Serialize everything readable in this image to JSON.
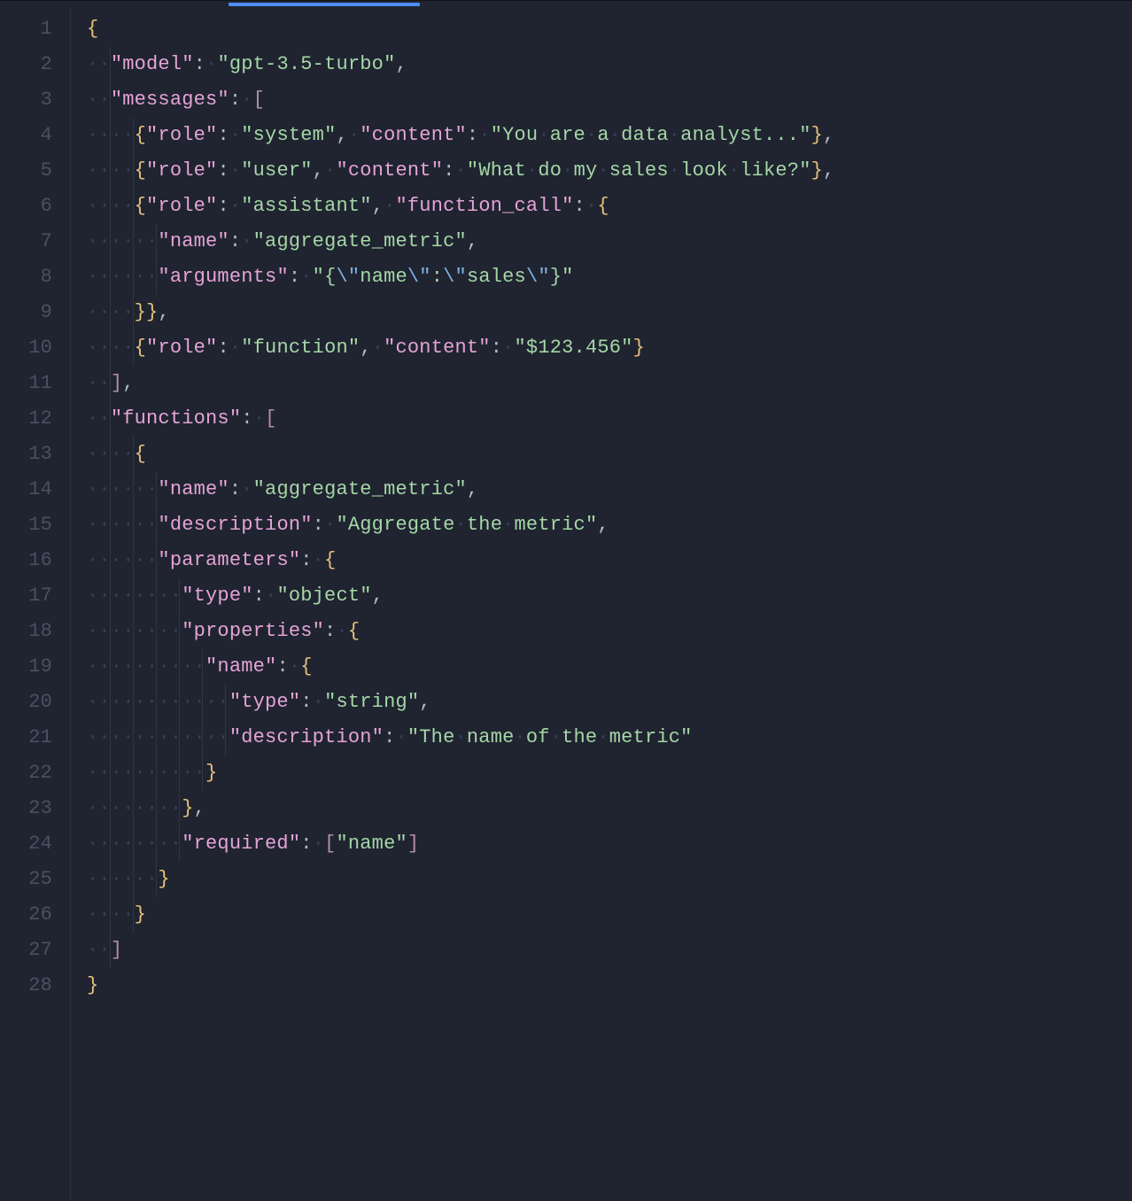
{
  "tab": {
    "active": true
  },
  "line_numbers": [
    "1",
    "2",
    "3",
    "4",
    "5",
    "6",
    "7",
    "8",
    "9",
    "10",
    "11",
    "12",
    "13",
    "14",
    "15",
    "16",
    "17",
    "18",
    "19",
    "20",
    "21",
    "22",
    "23",
    "24",
    "25",
    "26",
    "27",
    "28"
  ],
  "code_lines": [
    [
      {
        "t": "brace",
        "v": "{"
      }
    ],
    [
      {
        "t": "ws",
        "n": 2
      },
      {
        "t": "key",
        "v": "\"model\""
      },
      {
        "t": "punct",
        "v": ":"
      },
      {
        "t": "dot",
        "v": "·"
      },
      {
        "t": "str",
        "v": "\"gpt-3.5-turbo\""
      },
      {
        "t": "punct",
        "v": ","
      }
    ],
    [
      {
        "t": "ws",
        "n": 2
      },
      {
        "t": "key",
        "v": "\"messages\""
      },
      {
        "t": "punct",
        "v": ":"
      },
      {
        "t": "dot",
        "v": "·"
      },
      {
        "t": "bracket",
        "v": "["
      }
    ],
    [
      {
        "t": "ws",
        "n": 4
      },
      {
        "t": "brace",
        "v": "{"
      },
      {
        "t": "key",
        "v": "\"role\""
      },
      {
        "t": "punct",
        "v": ":"
      },
      {
        "t": "dot",
        "v": "·"
      },
      {
        "t": "str",
        "v": "\"system\""
      },
      {
        "t": "punct",
        "v": ","
      },
      {
        "t": "dot",
        "v": "·"
      },
      {
        "t": "key",
        "v": "\"content\""
      },
      {
        "t": "punct",
        "v": ":"
      },
      {
        "t": "dot",
        "v": "·"
      },
      {
        "t": "str",
        "v": "\"You·are·a·data·analyst...\""
      },
      {
        "t": "brace",
        "v": "}"
      },
      {
        "t": "punct",
        "v": ","
      }
    ],
    [
      {
        "t": "ws",
        "n": 4
      },
      {
        "t": "brace",
        "v": "{"
      },
      {
        "t": "key",
        "v": "\"role\""
      },
      {
        "t": "punct",
        "v": ":"
      },
      {
        "t": "dot",
        "v": "·"
      },
      {
        "t": "str",
        "v": "\"user\""
      },
      {
        "t": "punct",
        "v": ","
      },
      {
        "t": "dot",
        "v": "·"
      },
      {
        "t": "key",
        "v": "\"content\""
      },
      {
        "t": "punct",
        "v": ":"
      },
      {
        "t": "dot",
        "v": "·"
      },
      {
        "t": "str",
        "v": "\"What·do·my·sales·look·like?\""
      },
      {
        "t": "brace",
        "v": "}"
      },
      {
        "t": "punct",
        "v": ","
      }
    ],
    [
      {
        "t": "ws",
        "n": 4
      },
      {
        "t": "brace",
        "v": "{"
      },
      {
        "t": "key",
        "v": "\"role\""
      },
      {
        "t": "punct",
        "v": ":"
      },
      {
        "t": "dot",
        "v": "·"
      },
      {
        "t": "str",
        "v": "\"assistant\""
      },
      {
        "t": "punct",
        "v": ","
      },
      {
        "t": "dot",
        "v": "·"
      },
      {
        "t": "key",
        "v": "\"function_call\""
      },
      {
        "t": "punct",
        "v": ":"
      },
      {
        "t": "dot",
        "v": "·"
      },
      {
        "t": "brace",
        "v": "{"
      }
    ],
    [
      {
        "t": "ws",
        "n": 6
      },
      {
        "t": "key",
        "v": "\"name\""
      },
      {
        "t": "punct",
        "v": ":"
      },
      {
        "t": "dot",
        "v": "·"
      },
      {
        "t": "str",
        "v": "\"aggregate_metric\""
      },
      {
        "t": "punct",
        "v": ","
      }
    ],
    [
      {
        "t": "ws",
        "n": 6
      },
      {
        "t": "key",
        "v": "\"arguments\""
      },
      {
        "t": "punct",
        "v": ":"
      },
      {
        "t": "dot",
        "v": "·"
      },
      {
        "t": "str",
        "v": "\"{"
      },
      {
        "t": "esc",
        "v": "\\\""
      },
      {
        "t": "str",
        "v": "name"
      },
      {
        "t": "esc",
        "v": "\\\""
      },
      {
        "t": "str",
        "v": ":"
      },
      {
        "t": "esc",
        "v": "\\\""
      },
      {
        "t": "str",
        "v": "sales"
      },
      {
        "t": "esc",
        "v": "\\\""
      },
      {
        "t": "str",
        "v": "}\""
      }
    ],
    [
      {
        "t": "ws",
        "n": 4
      },
      {
        "t": "brace",
        "v": "}}"
      },
      {
        "t": "punct",
        "v": ","
      }
    ],
    [
      {
        "t": "ws",
        "n": 4
      },
      {
        "t": "brace",
        "v": "{"
      },
      {
        "t": "key",
        "v": "\"role\""
      },
      {
        "t": "punct",
        "v": ":"
      },
      {
        "t": "dot",
        "v": "·"
      },
      {
        "t": "str",
        "v": "\"function\""
      },
      {
        "t": "punct",
        "v": ","
      },
      {
        "t": "dot",
        "v": "·"
      },
      {
        "t": "key",
        "v": "\"content\""
      },
      {
        "t": "punct",
        "v": ":"
      },
      {
        "t": "dot",
        "v": "·"
      },
      {
        "t": "str",
        "v": "\"$123.456\""
      },
      {
        "t": "brace",
        "v": "}"
      }
    ],
    [
      {
        "t": "ws",
        "n": 2
      },
      {
        "t": "bracket",
        "v": "]"
      },
      {
        "t": "punct",
        "v": ","
      }
    ],
    [
      {
        "t": "ws",
        "n": 2
      },
      {
        "t": "key",
        "v": "\"functions\""
      },
      {
        "t": "punct",
        "v": ":"
      },
      {
        "t": "dot",
        "v": "·"
      },
      {
        "t": "bracket",
        "v": "["
      }
    ],
    [
      {
        "t": "ws",
        "n": 4
      },
      {
        "t": "brace",
        "v": "{"
      }
    ],
    [
      {
        "t": "ws",
        "n": 6
      },
      {
        "t": "key",
        "v": "\"name\""
      },
      {
        "t": "punct",
        "v": ":"
      },
      {
        "t": "dot",
        "v": "·"
      },
      {
        "t": "str",
        "v": "\"aggregate_metric\""
      },
      {
        "t": "punct",
        "v": ","
      }
    ],
    [
      {
        "t": "ws",
        "n": 6
      },
      {
        "t": "key",
        "v": "\"description\""
      },
      {
        "t": "punct",
        "v": ":"
      },
      {
        "t": "dot",
        "v": "·"
      },
      {
        "t": "str",
        "v": "\"Aggregate·the·metric\""
      },
      {
        "t": "punct",
        "v": ","
      }
    ],
    [
      {
        "t": "ws",
        "n": 6
      },
      {
        "t": "key",
        "v": "\"parameters\""
      },
      {
        "t": "punct",
        "v": ":"
      },
      {
        "t": "dot",
        "v": "·"
      },
      {
        "t": "brace",
        "v": "{"
      }
    ],
    [
      {
        "t": "ws",
        "n": 8
      },
      {
        "t": "key",
        "v": "\"type\""
      },
      {
        "t": "punct",
        "v": ":"
      },
      {
        "t": "dot",
        "v": "·"
      },
      {
        "t": "str",
        "v": "\"object\""
      },
      {
        "t": "punct",
        "v": ","
      }
    ],
    [
      {
        "t": "ws",
        "n": 8
      },
      {
        "t": "key",
        "v": "\"properties\""
      },
      {
        "t": "punct",
        "v": ":"
      },
      {
        "t": "dot",
        "v": "·"
      },
      {
        "t": "brace",
        "v": "{"
      }
    ],
    [
      {
        "t": "ws",
        "n": 10
      },
      {
        "t": "key",
        "v": "\"name\""
      },
      {
        "t": "punct",
        "v": ":"
      },
      {
        "t": "dot",
        "v": "·"
      },
      {
        "t": "brace",
        "v": "{"
      }
    ],
    [
      {
        "t": "ws",
        "n": 12
      },
      {
        "t": "key",
        "v": "\"type\""
      },
      {
        "t": "punct",
        "v": ":"
      },
      {
        "t": "dot",
        "v": "·"
      },
      {
        "t": "str",
        "v": "\"string\""
      },
      {
        "t": "punct",
        "v": ","
      }
    ],
    [
      {
        "t": "ws",
        "n": 12
      },
      {
        "t": "key",
        "v": "\"description\""
      },
      {
        "t": "punct",
        "v": ":"
      },
      {
        "t": "dot",
        "v": "·"
      },
      {
        "t": "str",
        "v": "\"The·name·of·the·metric\""
      }
    ],
    [
      {
        "t": "ws",
        "n": 10
      },
      {
        "t": "brace",
        "v": "}"
      }
    ],
    [
      {
        "t": "ws",
        "n": 8
      },
      {
        "t": "brace",
        "v": "}"
      },
      {
        "t": "punct",
        "v": ","
      }
    ],
    [
      {
        "t": "ws",
        "n": 8
      },
      {
        "t": "key",
        "v": "\"required\""
      },
      {
        "t": "punct",
        "v": ":"
      },
      {
        "t": "dot",
        "v": "·"
      },
      {
        "t": "bracket",
        "v": "["
      },
      {
        "t": "str",
        "v": "\"name\""
      },
      {
        "t": "bracket",
        "v": "]"
      }
    ],
    [
      {
        "t": "ws",
        "n": 6
      },
      {
        "t": "brace",
        "v": "}"
      }
    ],
    [
      {
        "t": "ws",
        "n": 4
      },
      {
        "t": "brace",
        "v": "}"
      }
    ],
    [
      {
        "t": "ws",
        "n": 2
      },
      {
        "t": "bracket",
        "v": "]"
      }
    ],
    [
      {
        "t": "brace",
        "v": "}"
      }
    ]
  ],
  "parsed_json": {
    "model": "gpt-3.5-turbo",
    "messages": [
      {
        "role": "system",
        "content": "You are a data analyst..."
      },
      {
        "role": "user",
        "content": "What do my sales look like?"
      },
      {
        "role": "assistant",
        "function_call": {
          "name": "aggregate_metric",
          "arguments": "{\"name\":\"sales\"}"
        }
      },
      {
        "role": "function",
        "content": "$123.456"
      }
    ],
    "functions": [
      {
        "name": "aggregate_metric",
        "description": "Aggregate the metric",
        "parameters": {
          "type": "object",
          "properties": {
            "name": {
              "type": "string",
              "description": "The name of the metric"
            }
          },
          "required": [
            "name"
          ]
        }
      }
    ]
  }
}
